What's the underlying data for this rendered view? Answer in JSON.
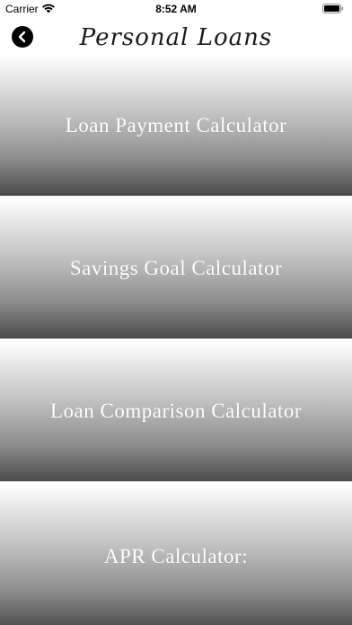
{
  "status_bar": {
    "carrier": "Carrier",
    "time": "8:52 AM",
    "wifi_icon": "wifi-icon",
    "battery_icon": "battery-icon"
  },
  "nav": {
    "title": "Personal Loans",
    "back_icon": "chevron-left-icon"
  },
  "menu": {
    "items": [
      {
        "label": "Loan Payment Calculator"
      },
      {
        "label": "Savings Goal Calculator"
      },
      {
        "label": "Loan Comparison Calculator"
      },
      {
        "label": "APR Calculator:"
      }
    ]
  },
  "colors": {
    "background": "#ffffff",
    "gradient_top": "#ffffff",
    "gradient_bottom": "#4a4a4a",
    "text_on_tile": "#ffffff"
  }
}
